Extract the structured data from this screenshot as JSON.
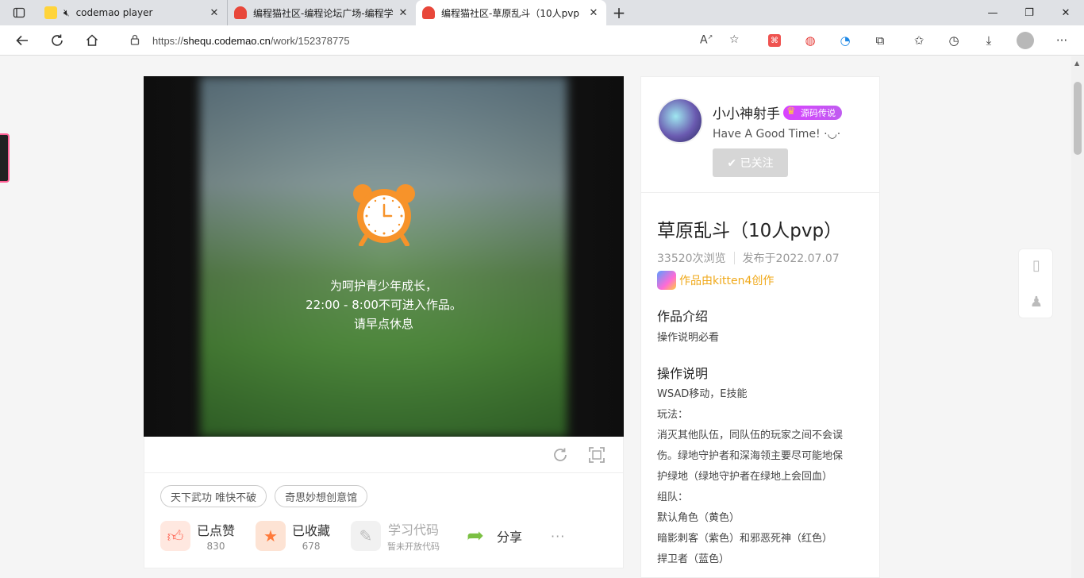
{
  "browser": {
    "tabs": [
      {
        "label": "codemao player",
        "close": "✕"
      },
      {
        "label": "编程猫社区-编程论坛广场-编程学",
        "close": "✕"
      },
      {
        "label": "编程猫社区-草原乱斗（10人pvp",
        "close": "✕"
      }
    ],
    "new_tab": "+",
    "url_prefix": "https://",
    "url_host": "shequ.codemao.cn",
    "url_path": "/work/152378775"
  },
  "player": {
    "notice_line1": "为呵护青少年成长，",
    "notice_line2": "22:00 - 8:00不可进入作品。",
    "notice_line3": "请早点休息"
  },
  "tags": [
    "天下武功 唯快不破",
    "奇思妙想创意馆"
  ],
  "actions": {
    "like_label": "已点赞",
    "like_count": "830",
    "collect_label": "已收藏",
    "collect_count": "678",
    "code_label": "学习代码",
    "code_sub": "暂未开放代码",
    "share_label": "分享",
    "more": "···"
  },
  "author": {
    "name": "小小神射手",
    "badge": "源码传说",
    "motto": "Have A Good Time! ·◡·",
    "follow_label": "✔ 已关注"
  },
  "work": {
    "title": "草原乱斗（10人pvp）",
    "views": "33520次浏览",
    "published": "发布于2022.07.07",
    "creator": "作品由kitten4创作",
    "intro_heading": "作品介绍",
    "intro_text": "操作说明必看",
    "howto_heading": "操作说明",
    "howto_lines": [
      "WSAD移动，E技能",
      "玩法：",
      "消灭其他队伍，同队伍的玩家之间不会误",
      "伤。绿地守护者和深海领主要尽可能地保",
      "护绿地（绿地守护者在绿地上会回血）",
      "组队：",
      "默认角色（黄色）",
      "暗影刺客（紫色）和邪恶死神（红色）",
      "捍卫者（蓝色）"
    ]
  },
  "colors": {
    "accent_orange": "#f7932a",
    "creator_gold": "#f0a91a",
    "badge_purple": "#d942ff"
  }
}
